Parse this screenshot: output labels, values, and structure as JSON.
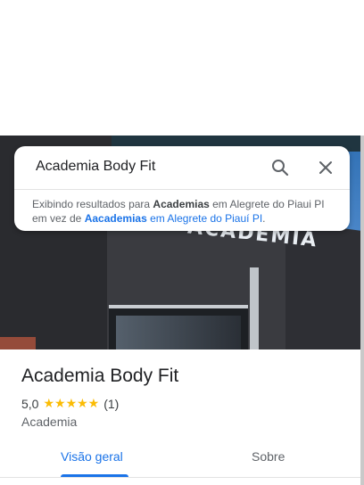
{
  "search": {
    "query": "Academia Body Fit",
    "notice_prefix": "Exibindo resultados para ",
    "notice_term1": "Academias",
    "notice_middle": " em Alegrete do Piaui PI em vez de ",
    "notice_link_term": "Aacademias",
    "notice_link_rest": " em Alegrete do Piauí PI",
    "notice_suffix": "."
  },
  "photo": {
    "sign_text": "ACADEMIA"
  },
  "place": {
    "name": "Academia Body Fit",
    "rating": "5,0",
    "stars": "★★★★★",
    "review_count": "(1)",
    "category": "Academia"
  },
  "tabs": [
    {
      "label": "Visão geral",
      "active": true
    },
    {
      "label": "Sobre",
      "active": false
    }
  ],
  "colors": {
    "accent": "#1a73e8",
    "star": "#fbbc04"
  },
  "icons": {
    "search": "search-icon",
    "close": "close-icon"
  }
}
